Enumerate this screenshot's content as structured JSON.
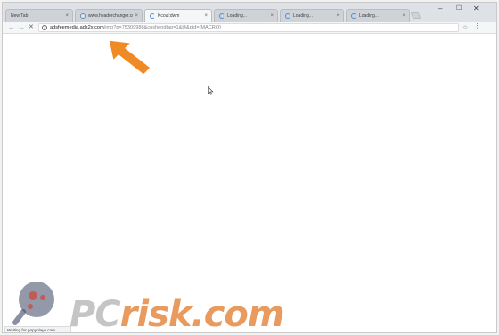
{
  "tabs": [
    {
      "title": "New Tab",
      "icon": "none",
      "active": false
    },
    {
      "title": "www.headerchanger.co",
      "icon": "globe-icon",
      "active": false
    },
    {
      "title": "Kcoul:dwm",
      "icon": "loading-spinner-icon",
      "active": true
    },
    {
      "title": "Loading...",
      "icon": "loading-spinner-icon",
      "active": false
    },
    {
      "title": "Loading...",
      "icon": "loading-spinner-icon",
      "active": false
    },
    {
      "title": "Loading...",
      "icon": "loading-spinner-icon",
      "active": false
    }
  ],
  "tab_close_glyph": "×",
  "window_controls": {
    "minimize": "–",
    "maximize": "☐",
    "close": "✕"
  },
  "toolbar": {
    "back": "←",
    "forward": "→",
    "stop": "✕",
    "info": "i",
    "url_host": "adsfeemedia.ads2x.com",
    "url_path": "/imp?p=75309988&coshendtap=1&t4&pid={MACRO}",
    "bookmark_star": "☆",
    "menu": "⋮"
  },
  "status_text": "Waiting for popyplaye.com...",
  "watermark": {
    "pc": "PC",
    "risk": "risk.com"
  },
  "colors": {
    "arrow": "#f08a24",
    "accent": "#4a90d9"
  }
}
